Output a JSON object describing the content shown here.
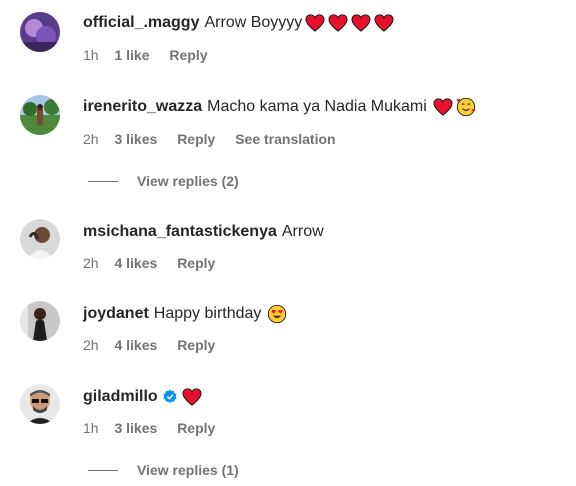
{
  "comments": [
    {
      "username": "official_.maggy",
      "text": "Arrow Boyyyy",
      "emojis": [
        "heart-icon",
        "heart-icon",
        "heart-icon",
        "heart-icon"
      ],
      "time": "1h",
      "likes": "1 like",
      "reply": "Reply"
    },
    {
      "username": "irenerito_wazza",
      "text": "Macho kama ya Nadia Mukami",
      "emojis": [
        "heart-icon",
        "smiling-face-with-hearts-icon"
      ],
      "time": "2h",
      "likes": "3 likes",
      "reply": "Reply",
      "translate": "See translation",
      "view_replies": "View replies (2)"
    },
    {
      "username": "msichana_fantastickenya",
      "text": "Arrow",
      "emojis": [],
      "time": "2h",
      "likes": "4 likes",
      "reply": "Reply"
    },
    {
      "username": "joydanet",
      "text": "Happy birthday",
      "emojis": [
        "heart-eyes-icon"
      ],
      "time": "2h",
      "likes": "4 likes",
      "reply": "Reply"
    },
    {
      "username": "giladmillo",
      "text": "",
      "verified": true,
      "emojis": [
        "heart-icon"
      ],
      "time": "1h",
      "likes": "3 likes",
      "reply": "Reply",
      "view_replies": "View replies (1)"
    }
  ],
  "colors": {
    "text": "#262626",
    "secondary": "#737373",
    "verified": "#0095f6",
    "heart": "#e8112d"
  }
}
